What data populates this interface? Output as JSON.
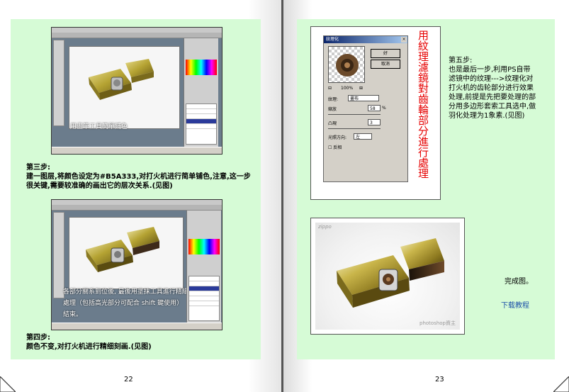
{
  "left_page": {
    "screenshot1_caption": "用畫筆工具簡單鋪色",
    "step3_title": "第三步:",
    "step3_text": "建一图层,将颜色设定为#B5A333,对打火机进行简单铺色,注意,这一步很关键,需要较准确的画出它的层次关系.(见图)",
    "screenshot2_caption": "各部分關系到位後, 最後用塗抹工具進行精細處理（包括高光部分可配合 shift 鍵使用）結束。",
    "step4_title": "第四步:",
    "step4_text": "颜色不变,对打火机进行精细刻画.(见图)",
    "page_number": "22"
  },
  "right_page": {
    "vertical_title": "用紋理濾鏡對齒輪部分進行處理",
    "dialog": {
      "title": "紋理化",
      "ok_label": "好",
      "cancel_label": "取消",
      "zoom": "100%",
      "texture_label": "紋理:",
      "texture_value": "畫布",
      "scaling_label": "縮放",
      "scaling_value": "58",
      "scaling_unit": "%",
      "relief_label": "凸現",
      "relief_value": "3",
      "light_label": "光照方向:",
      "light_value": "左",
      "invert_label": "反相"
    },
    "step5_title": "第五步:",
    "step5_text": "也是最后一步,利用PS自带滤镜中的纹理--->纹理化对打火机的齿轮部分进行效果处理,前提是先把要处理的部分用多边形套索工具选中,做羽化处理为1象素.(见图)",
    "final_brand": "zippo",
    "final_watermark": "photoshop資主",
    "done_label": "完成图。",
    "download_link": "下载教程",
    "page_number": "23"
  },
  "colors": {
    "panel_green": "#D6FBD6",
    "title_red": "#E60000",
    "link_blue": "#1A4FA8",
    "brass": "#B5A333"
  }
}
